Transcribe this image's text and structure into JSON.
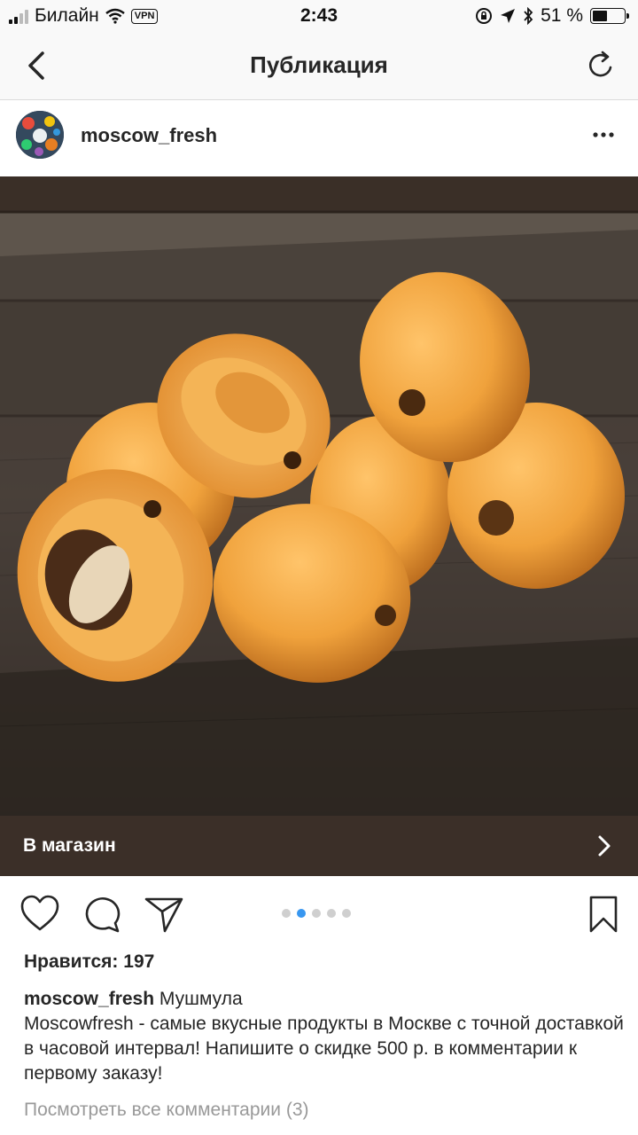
{
  "status_bar": {
    "carrier": "Билайн",
    "vpn_label": "VPN",
    "time": "2:43",
    "battery_percent": "51 %",
    "battery_level": 0.51
  },
  "nav": {
    "title": "Публикация",
    "back_icon": "chevron-left-icon",
    "refresh_icon": "refresh-icon"
  },
  "post": {
    "username": "moscow_fresh",
    "more_icon": "more-horizontal-icon",
    "image_description_icon": "photo-of-loquat-fruits",
    "shop_label": "В магазин",
    "carousel": {
      "total": 5,
      "active_index": 1
    },
    "likes": "Нравится: 197",
    "caption_user": "moscow_fresh",
    "caption_title": "Мушмула",
    "caption_text": "Moscowfresh - самые вкусные продукты в Москве с точной доставкой в часовой интервал! Напишите о скидке 500 р. в комментарии к первому заказу!",
    "view_comments": "Посмотреть все комментарии (3)"
  },
  "colors": {
    "accent_blue": "#3897f0",
    "shop_bar": "#3b2f28",
    "fruit": "#f0a23c"
  }
}
